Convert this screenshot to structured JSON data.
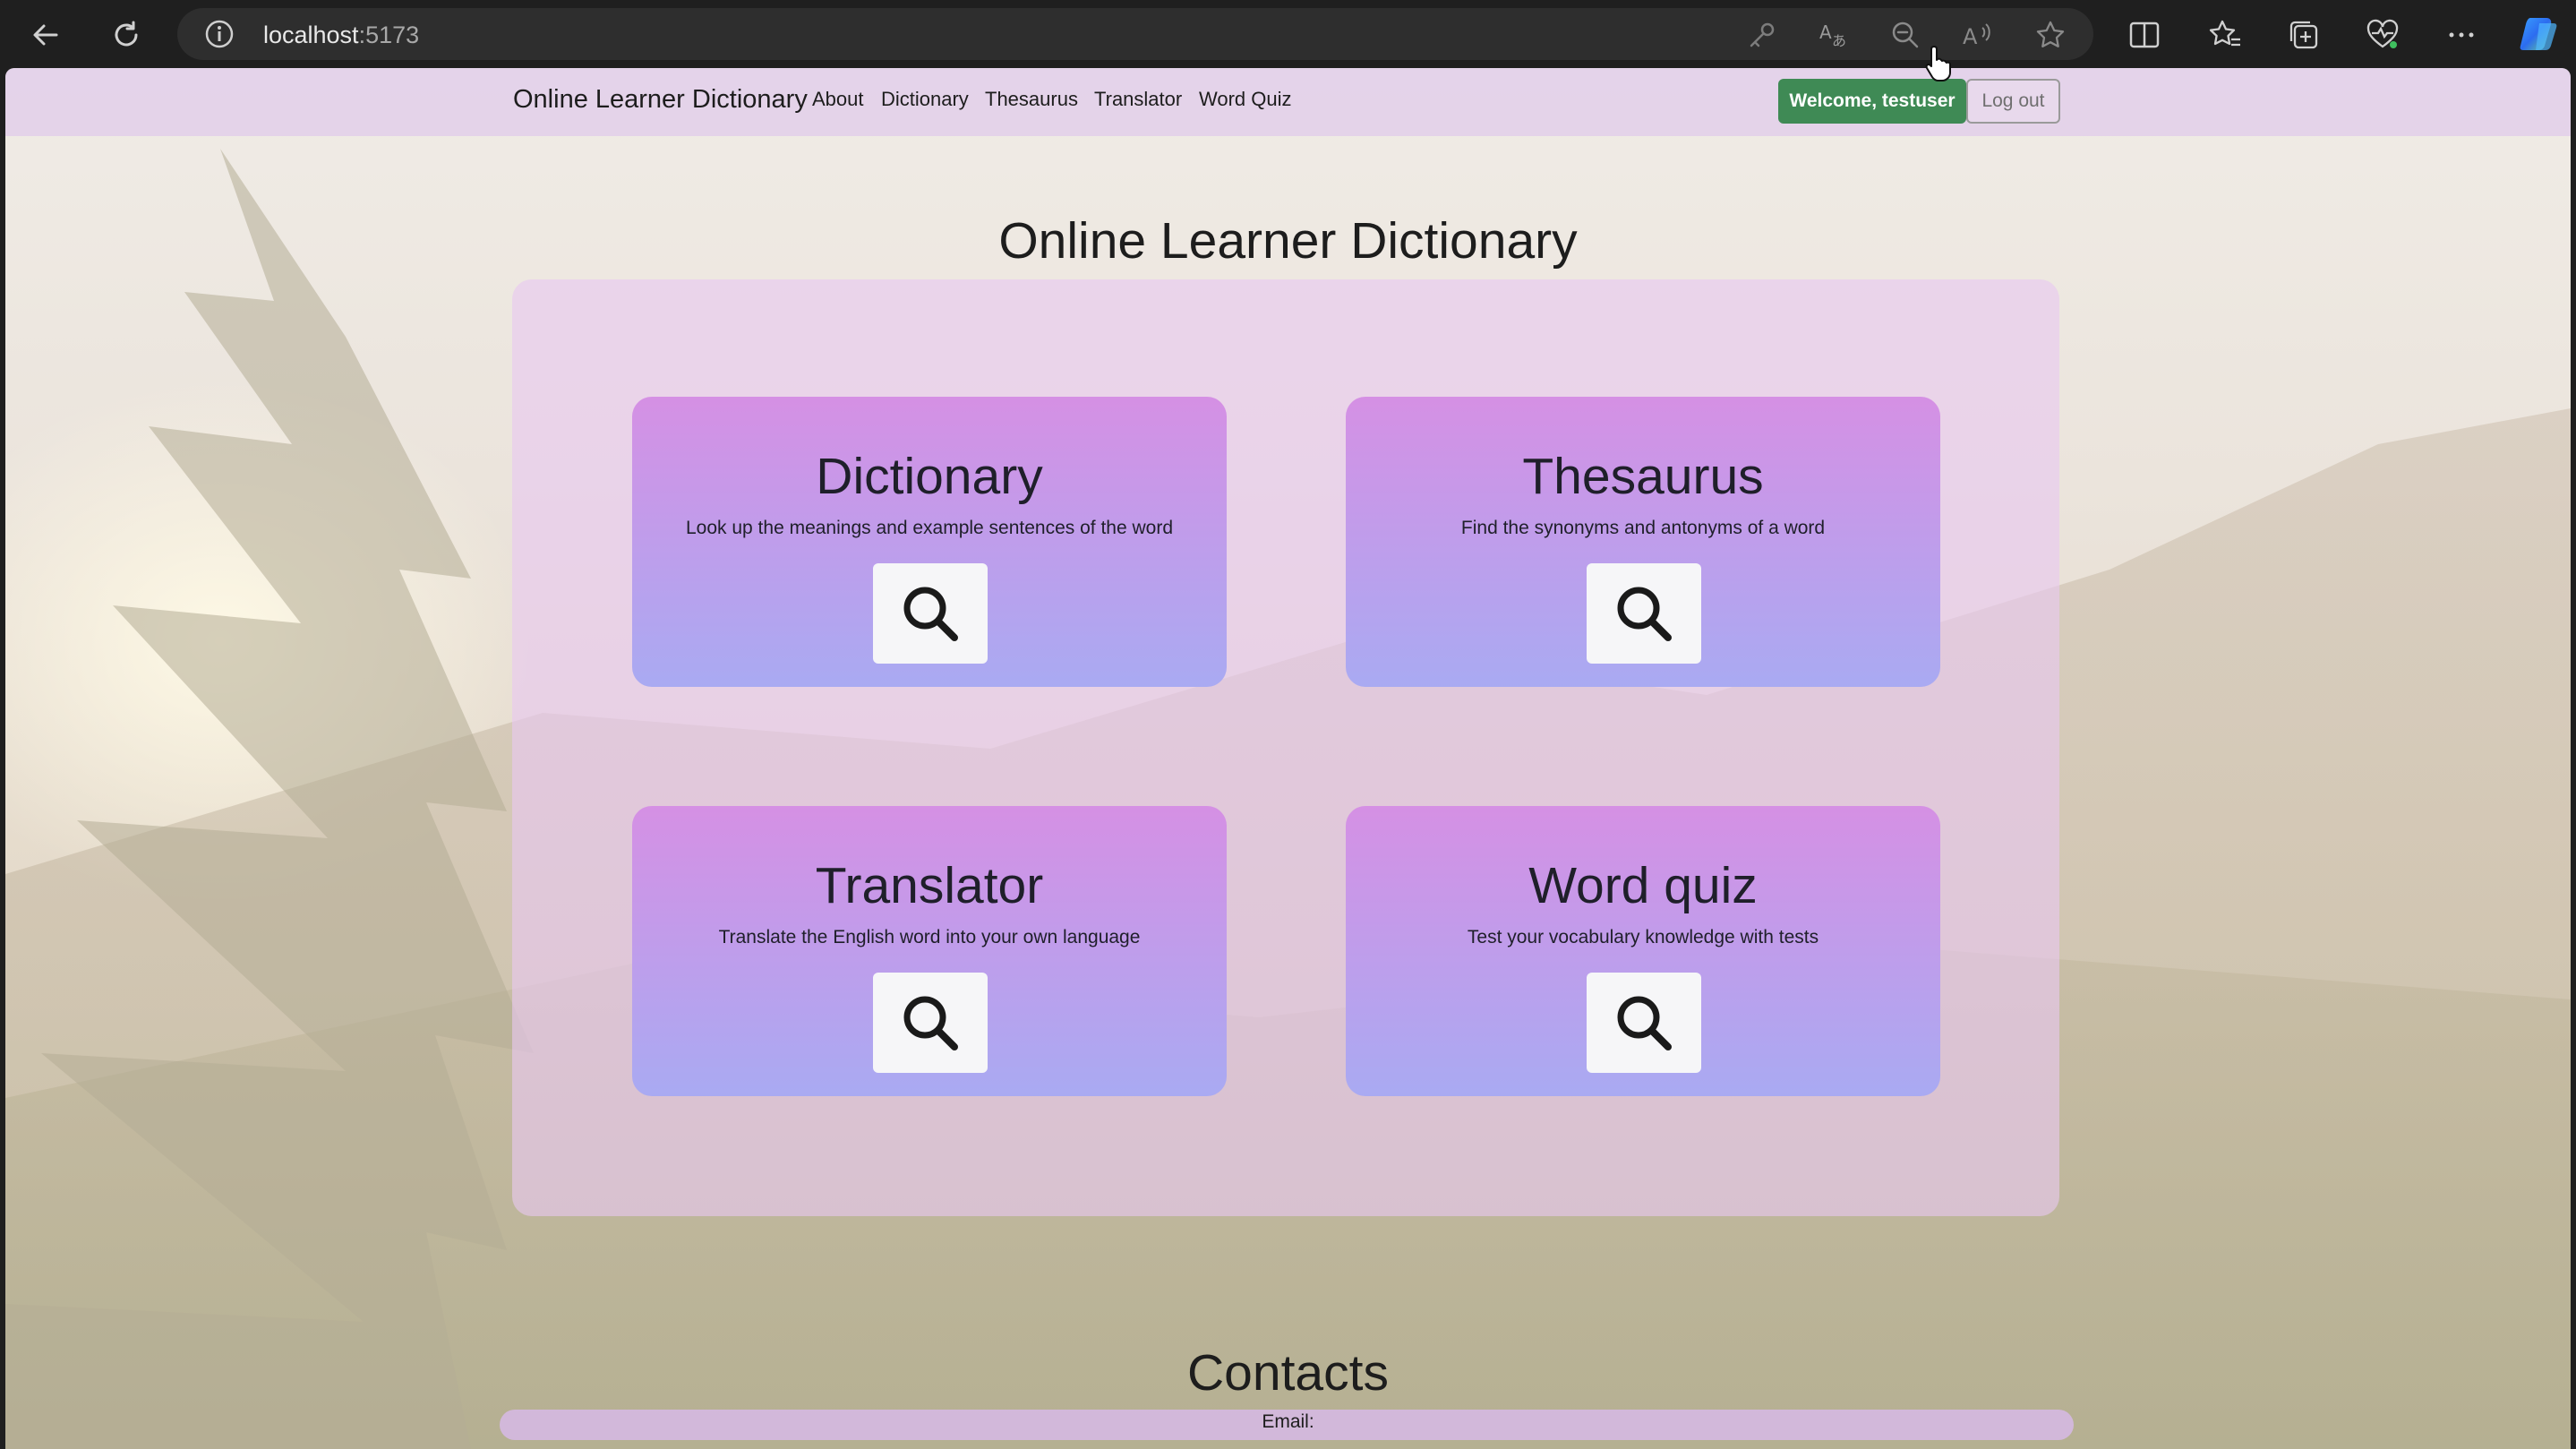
{
  "browser": {
    "url_host": "localhost",
    "url_port": ":5173"
  },
  "navbar": {
    "brand": "Online Learner Dictionary",
    "links": [
      "About",
      "Dictionary",
      "Thesaurus",
      "Translator",
      "Word Quiz"
    ],
    "welcome_label": "Welcome, testuser",
    "logout_label": "Log out"
  },
  "main": {
    "title": "Online Learner Dictionary",
    "cards": [
      {
        "title": "Dictionary",
        "description": "Look up the meanings and example sentences of the word",
        "icon": "search-icon"
      },
      {
        "title": "Thesaurus",
        "description": "Find the synonyms and antonyms of a word",
        "icon": "search-icon"
      },
      {
        "title": "Translator",
        "description": "Translate the English word into your own language",
        "icon": "search-icon"
      },
      {
        "title": "Word quiz",
        "description": "Test your vocabulary knowledge with tests",
        "icon": "search-icon"
      }
    ]
  },
  "contacts": {
    "title": "Contacts",
    "email_label": "Email:"
  },
  "colors": {
    "welcome_bg": "#3f8a55",
    "card_top": "#d590e4",
    "card_bottom": "#a9aaf2",
    "panel": "#e8c8f0"
  }
}
